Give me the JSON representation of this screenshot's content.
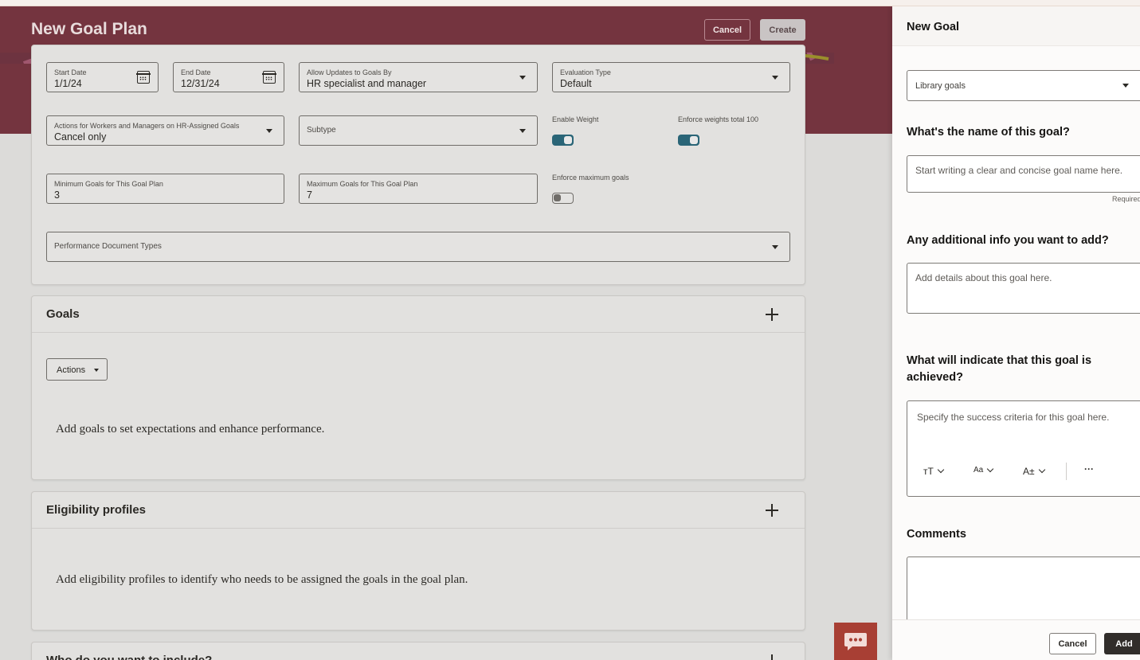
{
  "header": {
    "title": "New Goal Plan",
    "cancel_label": "Cancel",
    "create_label": "Create"
  },
  "details": {
    "start_date": {
      "label": "Start Date",
      "value": "1/1/24"
    },
    "end_date": {
      "label": "End Date",
      "value": "12/31/24"
    },
    "allow_updates": {
      "label": "Allow Updates to Goals By",
      "value": "HR specialist and manager"
    },
    "evaluation_type": {
      "label": "Evaluation Type",
      "value": "Default"
    },
    "actions_hr_goals": {
      "label": "Actions for Workers and Managers on HR-Assigned Goals",
      "value": "Cancel only"
    },
    "subtype": {
      "label": "Subtype"
    },
    "enable_weight": {
      "label": "Enable Weight",
      "on": true
    },
    "enforce_weights": {
      "label": "Enforce weights total 100",
      "on": true
    },
    "min_goals": {
      "label": "Minimum Goals for This Goal Plan",
      "value": "3"
    },
    "max_goals": {
      "label": "Maximum Goals for This Goal Plan",
      "value": "7"
    },
    "enforce_max": {
      "label": "Enforce maximum goals",
      "on": false
    },
    "perf_doc_types": {
      "label": "Performance Document Types"
    }
  },
  "goals_section": {
    "title": "Goals",
    "actions_label": "Actions",
    "empty_message": "Add goals to set expectations and enhance performance."
  },
  "eligibility_section": {
    "title": "Eligibility profiles",
    "empty_message": "Add eligibility profiles to identify who needs to be assigned the goals in the goal plan."
  },
  "include_section": {
    "title": "Who do you want to include?"
  },
  "drawer": {
    "title": "New Goal",
    "source_select": "Library goals",
    "name_question": "What's the name of this goal?",
    "name_placeholder": "Start writing a clear and concise goal name here.",
    "required_label": "Required",
    "info_question": "Any additional info you want to add?",
    "info_placeholder": "Add details about this goal here.",
    "success_question": "What will indicate that this goal is achieved?",
    "success_placeholder": "Specify the success criteria for this goal here.",
    "rte_tools": {
      "format": "тТ",
      "font": "Aa",
      "size": "A±",
      "more": "···"
    },
    "comments_label": "Comments",
    "cancel_label": "Cancel",
    "add_label": "Add"
  },
  "colors": {
    "header_band": "#74343f",
    "toggle_on": "#2a6577",
    "chat_fab": "#a83f34",
    "add_button": "#312d2a"
  }
}
